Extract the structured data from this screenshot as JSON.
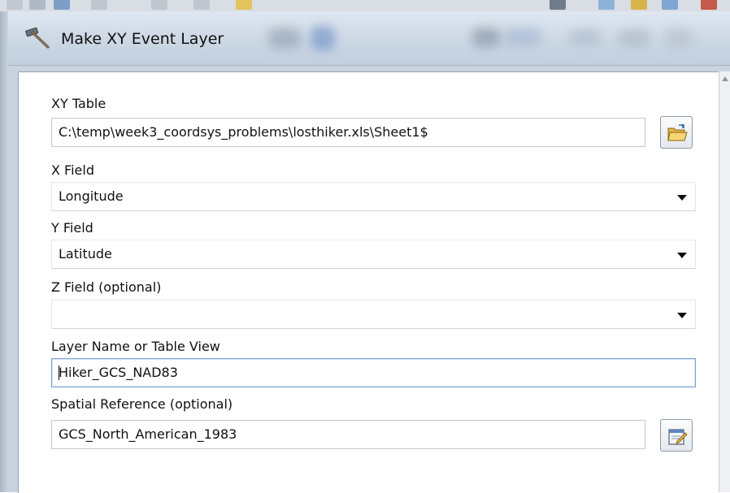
{
  "window": {
    "title": "Make XY Event Layer"
  },
  "form": {
    "xy_table": {
      "label": "XY Table",
      "value": "C:\\temp\\week3_coordsys_problems\\losthiker.xls\\Sheet1$"
    },
    "x_field": {
      "label": "X Field",
      "value": "Longitude"
    },
    "y_field": {
      "label": "Y Field",
      "value": "Latitude"
    },
    "z_field": {
      "label": "Z Field (optional)",
      "value": ""
    },
    "layer_name": {
      "label": "Layer Name or Table View",
      "value": "Hiker_GCS_NAD83"
    },
    "spatial_reference": {
      "label": "Spatial Reference (optional)",
      "value": "GCS_North_American_1983"
    }
  },
  "icons": {
    "title": "hammer-icon",
    "xy_table_browse": "open-folder-icon",
    "spatial_ref_browse": "spatial-reference-properties-icon"
  },
  "colors": {
    "titlebar": "#cbd6e3",
    "focus_border": "#7da2ce",
    "body": "#ffffff"
  }
}
